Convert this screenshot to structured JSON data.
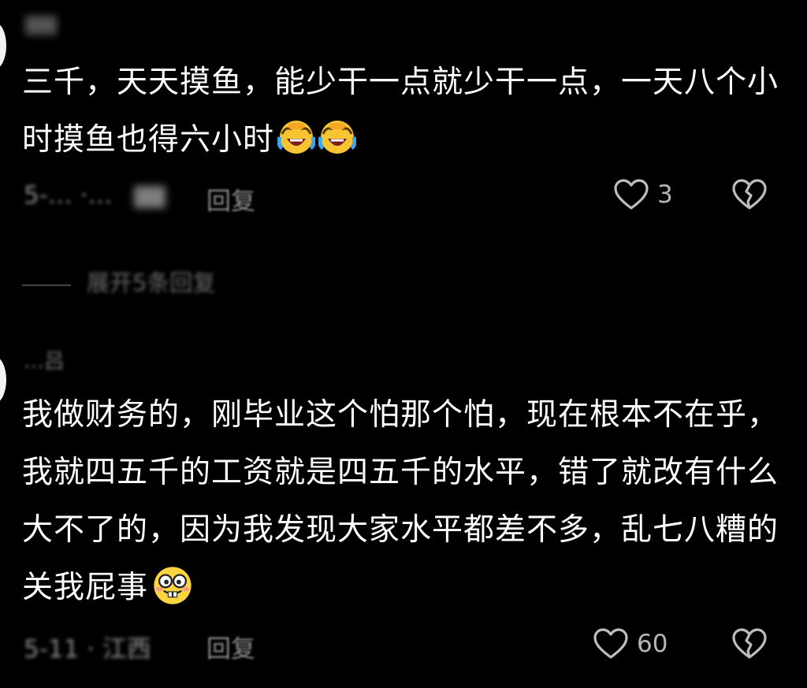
{
  "comments": [
    {
      "text": "三千，天天摸鱼，能少干一点就少干一点，一天八个小时摸鱼也得六小时",
      "emojis": [
        "rofl-emoji",
        "rofl-emoji"
      ],
      "date_location": "5-… ·…",
      "reply_label": "回复",
      "like_count": "3"
    },
    {
      "username": "…吕",
      "text": "我做财务的，刚毕业这个怕那个怕，现在根本不在乎，我就四五千的工资就是四五千的水平，错了就改有什么大不了的，因为我发现大家水平都差不多，乱七八糟的关我屁事",
      "emojis": [
        "buck-teeth-emoji"
      ],
      "date_location": "5-11 · 江西",
      "reply_label": "回复",
      "like_count": "60"
    }
  ],
  "expand_replies": "展开5条回复",
  "colors": {
    "background": "#000000",
    "text": "#ffffff",
    "meta": "#8c8c8c"
  }
}
